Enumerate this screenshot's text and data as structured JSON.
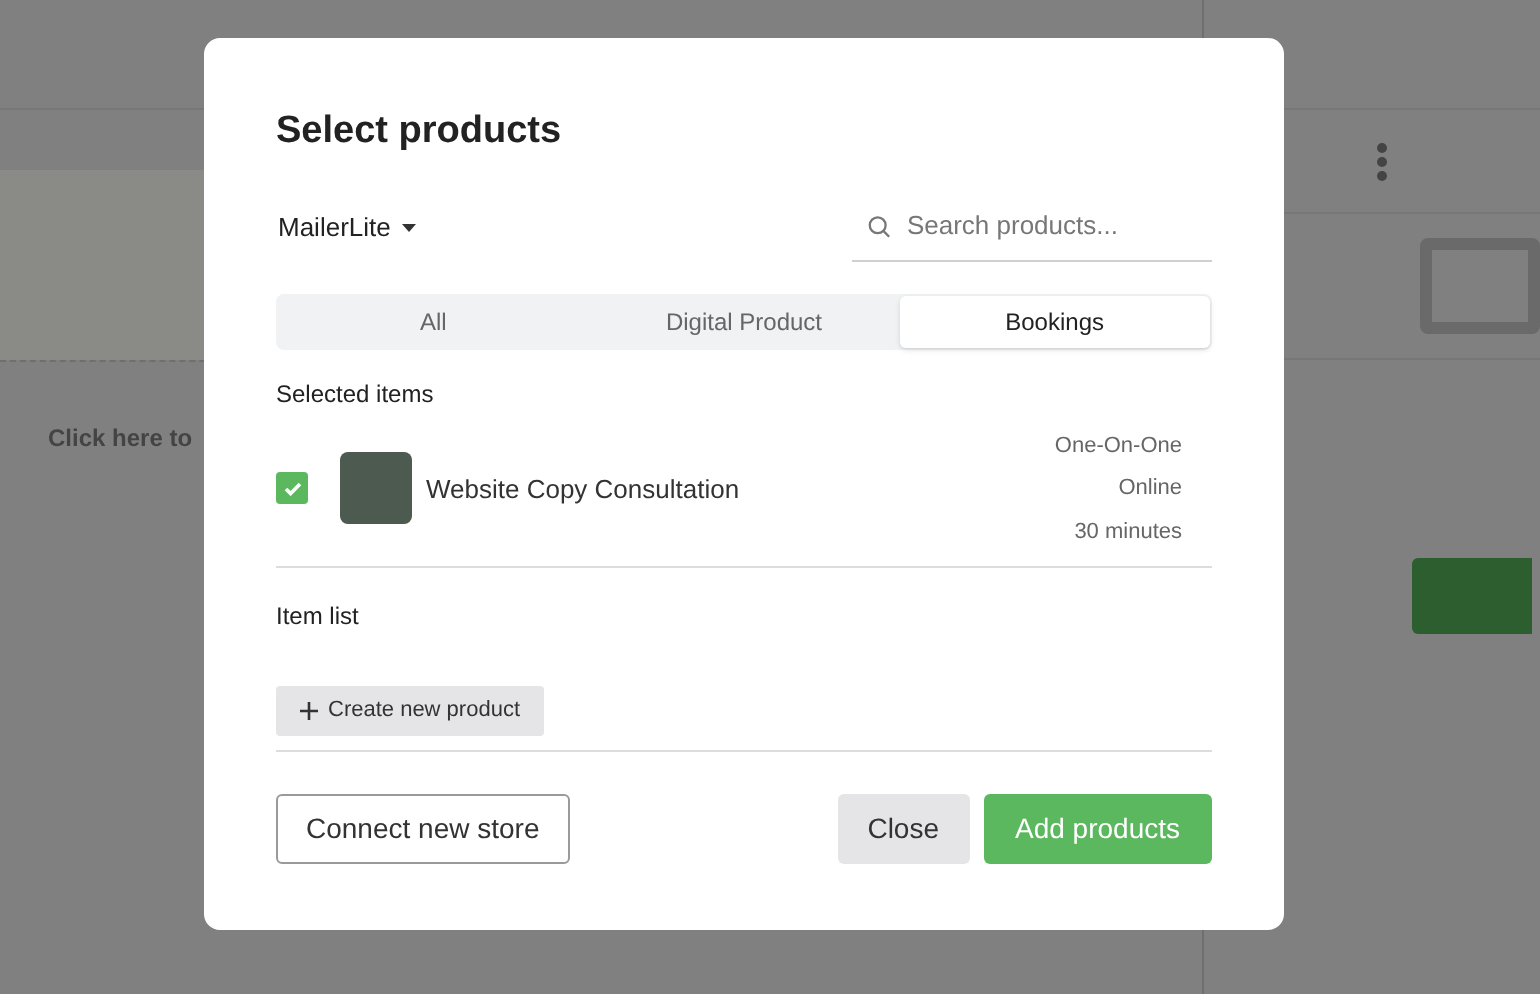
{
  "background": {
    "hint": "Click here to"
  },
  "dialog": {
    "title": "Select products",
    "store": {
      "label": "MailerLite"
    },
    "search": {
      "placeholder": "Search products..."
    },
    "tabs": [
      {
        "label": "All",
        "selected": false
      },
      {
        "label": "Digital Product",
        "selected": false
      },
      {
        "label": "Bookings",
        "selected": true
      }
    ],
    "selected_heading": "Selected items",
    "selected_items": [
      {
        "name": "Website Copy Consultation",
        "checked": true,
        "details": [
          "One-On-One",
          "Online",
          "30 minutes"
        ]
      }
    ],
    "list_heading": "Item list",
    "create_button": "Create new product",
    "buttons": [
      {
        "kind": "outline",
        "label": "Connect new store"
      },
      {
        "kind": "secondary",
        "label": "Close"
      },
      {
        "kind": "primary",
        "label": "Add products"
      }
    ]
  }
}
